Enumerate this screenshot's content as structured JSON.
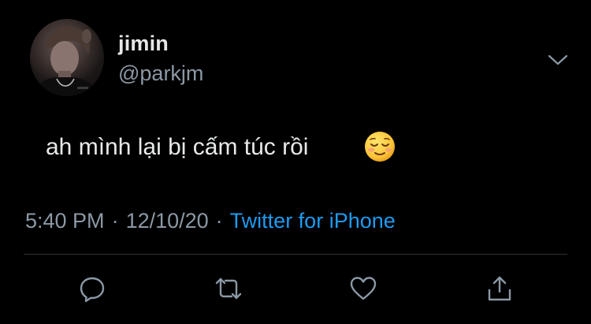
{
  "tweet": {
    "author": {
      "display_name": "jimin",
      "handle": "@parkjm",
      "avatar_icon": "profile-photo"
    },
    "text": "ah mình lại bị cấm túc rồi",
    "emoji": "relieved-face",
    "meta": {
      "time": "5:40 PM",
      "separator": "·",
      "date": "12/10/20",
      "source": "Twitter for iPhone"
    },
    "actions": [
      {
        "name": "reply",
        "icon": "reply-icon"
      },
      {
        "name": "retweet",
        "icon": "retweet-icon"
      },
      {
        "name": "like",
        "icon": "heart-icon"
      },
      {
        "name": "share",
        "icon": "share-icon"
      }
    ]
  },
  "colors": {
    "background": "#000000",
    "primary_text": "#e7e9ea",
    "secondary_text": "#8b98a5",
    "link": "#1d9bf0",
    "divider": "#2f3336"
  }
}
